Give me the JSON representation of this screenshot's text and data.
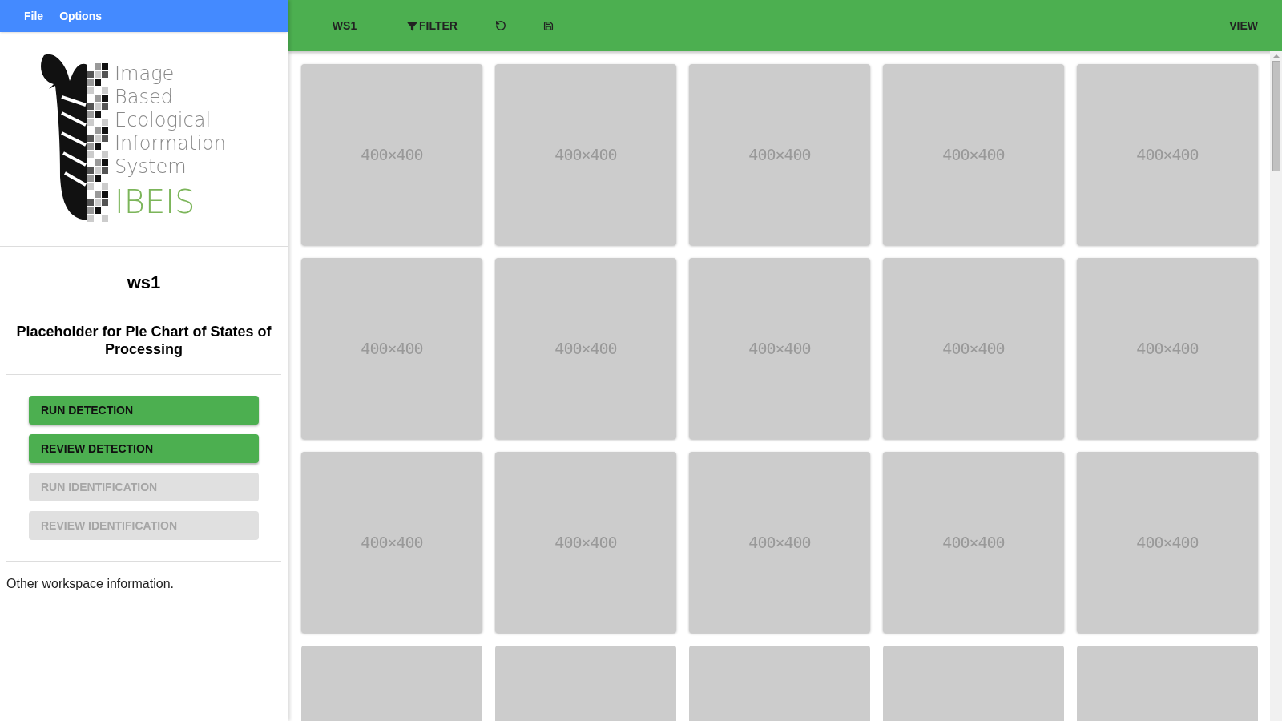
{
  "menu_bar": {
    "items": [
      {
        "label": "File"
      },
      {
        "label": "Options"
      }
    ]
  },
  "logo": {
    "lines": [
      "Image",
      "Based",
      "Ecological",
      "Information",
      "System"
    ],
    "wordmark": "IBEIS"
  },
  "workspace": {
    "name": "ws1",
    "chart_placeholder": "Placeholder for Pie Chart of States of Processing",
    "info": "Other workspace information."
  },
  "actions": [
    {
      "label": "RUN DETECTION",
      "disabled": false
    },
    {
      "label": "REVIEW DETECTION",
      "disabled": false
    },
    {
      "label": "RUN IDENTIFICATION",
      "disabled": true
    },
    {
      "label": "REVIEW IDENTIFICATION",
      "disabled": true
    }
  ],
  "toolbar": {
    "items": [
      {
        "kind": "text",
        "label": "WS1"
      },
      {
        "kind": "filter",
        "label": "FILTER"
      },
      {
        "kind": "undo"
      },
      {
        "kind": "save"
      }
    ],
    "right": "VIEW"
  },
  "tiles": [
    {
      "label": "400×400"
    },
    {
      "label": "400×400"
    },
    {
      "label": "400×400"
    },
    {
      "label": "400×400"
    },
    {
      "label": "400×400"
    },
    {
      "label": "400×400"
    },
    {
      "label": "400×400"
    },
    {
      "label": "400×400"
    },
    {
      "label": "400×400"
    },
    {
      "label": "400×400"
    },
    {
      "label": "400×400"
    },
    {
      "label": "400×400"
    },
    {
      "label": "400×400"
    },
    {
      "label": "400×400"
    },
    {
      "label": "400×400"
    },
    {
      "kind": "cut"
    },
    {
      "kind": "cut"
    },
    {
      "kind": "cut"
    },
    {
      "kind": "cut"
    },
    {
      "kind": "cut"
    }
  ]
}
